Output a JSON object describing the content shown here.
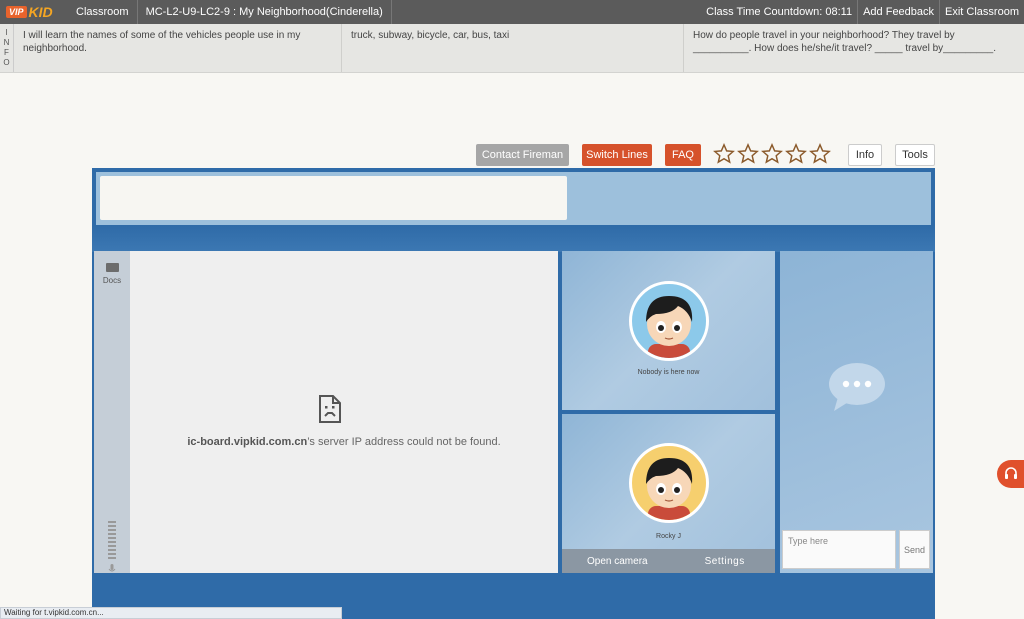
{
  "logo": {
    "vip": "VIP",
    "kid": "KID"
  },
  "topbar": {
    "classroom": "Classroom",
    "lesson": "MC-L2-U9-LC2-9 : My Neighborhood(Cinderella)",
    "countdown_label": "Class Time Countdown:",
    "countdown_value": "08:11",
    "add_feedback": "Add Feedback",
    "exit_classroom": "Exit Classroom"
  },
  "info": {
    "tag": [
      "I",
      "N",
      "F",
      "O"
    ],
    "objective": "I will learn the names of some of the vehicles people use in my neighborhood.",
    "vocabulary": "truck, subway, bicycle, car, bus, taxi",
    "sentences": "How do people travel in your neighborhood? They travel by __________. How does he/she/it travel? _____ travel by_________."
  },
  "controls": {
    "contact_fireman": "Contact Fireman",
    "switch_lines": "Switch Lines",
    "faq": "FAQ",
    "rating_stars": 0,
    "rating_max": 5,
    "info": "Info",
    "tools": "Tools"
  },
  "sidebar": {
    "docs": "Docs"
  },
  "board": {
    "host": "ic-board.vipkid.com.cn",
    "error": "’s server IP address could not be found."
  },
  "video_teacher": {
    "status": "Nobody is here now"
  },
  "video_student": {
    "name": "Rocky J",
    "open_camera": "Open camera",
    "settings": "Settings"
  },
  "chat": {
    "placeholder": "Type here",
    "send": "Send"
  },
  "statusbar": {
    "text": "Waiting for t.vipkid.com.cn..."
  },
  "colors": {
    "accent": "#d6522b",
    "frame": "#2f6ba8",
    "topbar": "#5b5b5b"
  }
}
